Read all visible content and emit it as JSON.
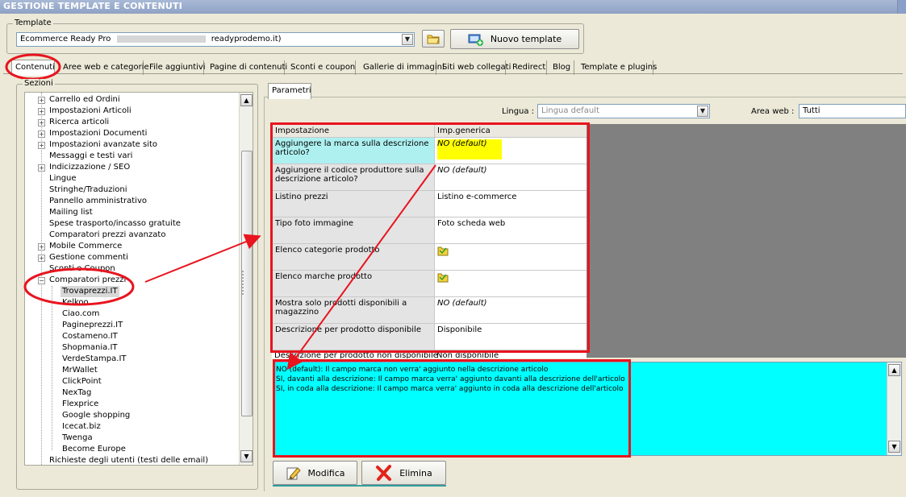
{
  "window": {
    "title": "GESTIONE TEMPLATE E CONTENUTI"
  },
  "template_group": {
    "label": "Template",
    "combo_value": "Ecommerce Ready Pro",
    "combo_suffix": "readyprodemo.it)",
    "open_icon": "folder-open-icon",
    "new_button": "Nuovo template"
  },
  "tabs": [
    "Contenuti",
    "Aree web e categorie",
    "File aggiuntivi",
    "Pagine di contenuti",
    "Sconti e coupon",
    "Gallerie di immagini",
    "Siti web collegati",
    "Redirect",
    "Blog",
    "Template e plugins"
  ],
  "sections": {
    "label": "Sezioni",
    "items": [
      "Carrello ed Ordini",
      "Impostazioni Articoli",
      "Ricerca articoli",
      "Impostazioni Documenti",
      "Impostazioni avanzate sito",
      "Messaggi e testi vari",
      "Indicizzazione / SEO",
      "Lingue",
      "Stringhe/Traduzioni",
      "Pannello amministrativo",
      "Mailing list",
      "Spese trasporto/incasso gratuite",
      "Comparatori prezzi avanzato",
      "Mobile Commerce",
      "Gestione commenti",
      "Sconti e Coupon",
      "Comparatori prezzi"
    ],
    "children": [
      "Trovaprezzi.IT",
      "Kelkoo",
      "Ciao.com",
      "Pagineprezzi.IT",
      "Costameno.IT",
      "Shopmania.IT",
      "VerdeStampa.IT",
      "MrWallet",
      "ClickPoint",
      "NexTag",
      "Flexprice",
      "Google shopping",
      "Icecat.biz",
      "Twenga",
      "Become Europe"
    ],
    "last_item": "Richieste degli utenti (testi delle email)"
  },
  "params": {
    "tab": "Parametri",
    "lingua_label": "Lingua :",
    "lingua_value": "Lingua default",
    "area_label": "Area web :",
    "area_value": "Tutti",
    "headers": [
      "Impostazione",
      "Imp.generica"
    ],
    "rows": [
      {
        "setting": "Aggiungere la marca sulla descrizione articolo?",
        "value": "NO (default)"
      },
      {
        "setting": "Aggiungere il codice produttore sulla descrizione articolo?",
        "value": "NO (default)"
      },
      {
        "setting": "Listino prezzi",
        "value": "Listino e-commerce"
      },
      {
        "setting": "Tipo foto immagine",
        "value": "Foto scheda web"
      },
      {
        "setting": "Elenco categorie prodotto",
        "value": ""
      },
      {
        "setting": "Elenco marche prodotto",
        "value": ""
      },
      {
        "setting": "Mostra solo prodotti disponibili a magazzino",
        "value": "NO (default)"
      },
      {
        "setting": "Descrizione per prodotto disponibile",
        "value": "Disponibile"
      },
      {
        "setting": "Descrizione per prodotto non disponibile",
        "value": "Non disponibile"
      }
    ],
    "description_lines": [
      "NO (default): Il campo marca non verra' aggiunto nella descrizione articolo",
      "SI, davanti alla descrizione: Il campo marca verra' aggiunto davanti alla descrizione dell'articolo",
      "SI, in coda alla descrizione: Il campo marca verra' aggiunto in coda alla descrizione dell'articolo"
    ],
    "modify_button": "Modifica",
    "delete_button": "Elimina"
  },
  "colors": {
    "highlight_cyan": "#aef0f0",
    "highlight_yellow": "#ffff00",
    "description_bg": "#00ffff",
    "annotation_red": "#e8141e"
  }
}
